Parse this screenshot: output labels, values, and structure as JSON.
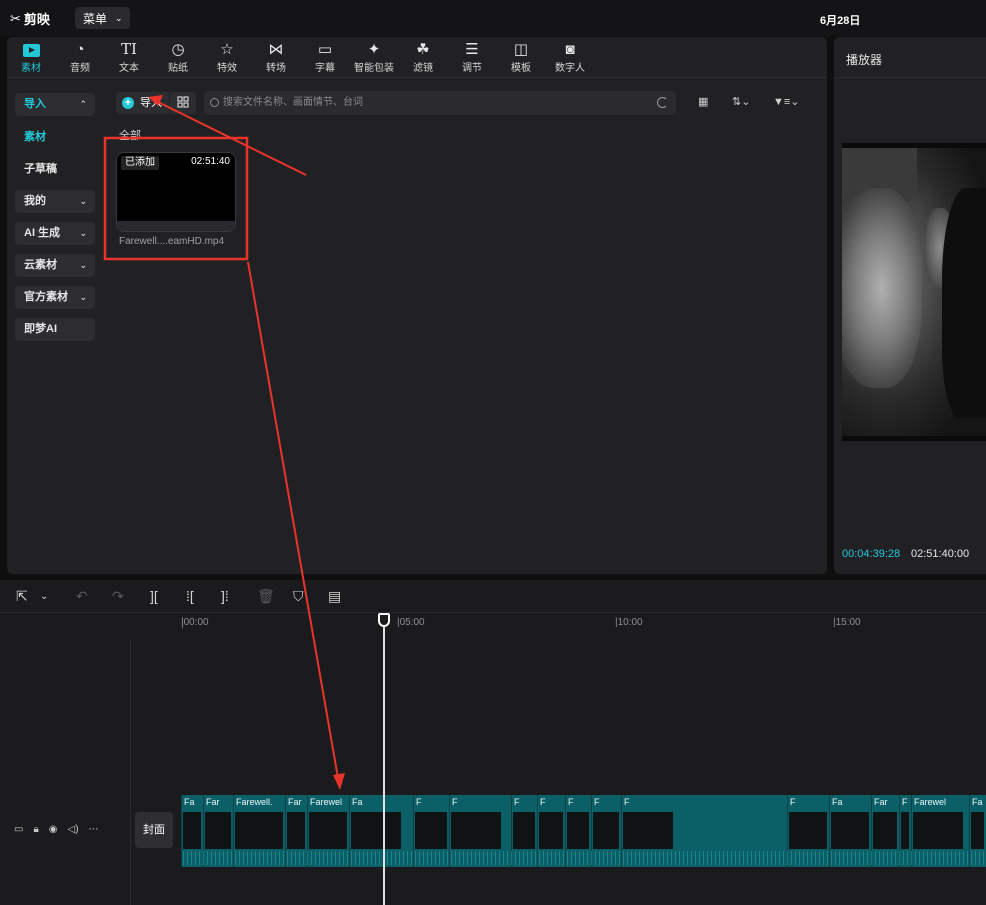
{
  "app": {
    "logo_text": "剪映",
    "menu_label": "菜单",
    "date": "6月28日"
  },
  "tools": [
    {
      "label": "素材",
      "icon": "media-icon"
    },
    {
      "label": "音频",
      "icon": "audio-icon"
    },
    {
      "label": "文本",
      "icon": "text-icon"
    },
    {
      "label": "贴纸",
      "icon": "sticker-icon"
    },
    {
      "label": "特效",
      "icon": "effects-icon"
    },
    {
      "label": "转场",
      "icon": "transition-icon"
    },
    {
      "label": "字幕",
      "icon": "subtitle-icon"
    },
    {
      "label": "智能包装",
      "icon": "smart-pack-icon"
    },
    {
      "label": "滤镜",
      "icon": "filter-icon"
    },
    {
      "label": "调节",
      "icon": "adjust-icon"
    },
    {
      "label": "模板",
      "icon": "template-icon"
    },
    {
      "label": "数字人",
      "icon": "avatar-icon"
    }
  ],
  "sidebar": {
    "items": [
      {
        "label": "导入",
        "chev": "⌃"
      },
      {
        "label": "素材",
        "chev": ""
      },
      {
        "label": "子草稿",
        "chev": ""
      },
      {
        "label": "我的",
        "chev": "⌄"
      },
      {
        "label": "AI 生成",
        "chev": "⌄"
      },
      {
        "label": "云素材",
        "chev": "⌄"
      },
      {
        "label": "官方素材",
        "chev": "⌄"
      },
      {
        "label": "即梦AI",
        "chev": ""
      }
    ]
  },
  "library": {
    "import_label": "导入",
    "search_placeholder": "搜索文件名称、画面情节、台词",
    "section_label": "全部",
    "card": {
      "badge": "已添加",
      "duration": "02:51:40",
      "filename": "Farewell....eamHD.mp4"
    }
  },
  "player": {
    "title": "播放器",
    "current_time": "00:04:39:28",
    "total_time": "02:51:40:00"
  },
  "timeline": {
    "ruler": [
      "|00:00",
      "|05:00",
      "|10:00",
      "|15:00"
    ],
    "cover_label": "封面",
    "clip_labels": [
      "Fa",
      "Far",
      "Farewell.",
      "Far",
      "Farewel",
      "Fa",
      "F",
      "F",
      "F",
      "F",
      "F",
      "F",
      "F",
      "F",
      "Fa",
      "Far",
      "F",
      "Farewel",
      "Fa"
    ]
  },
  "colors": {
    "accent": "#22c8d8",
    "track": "#0b6068",
    "annotation": "#e8342a"
  }
}
